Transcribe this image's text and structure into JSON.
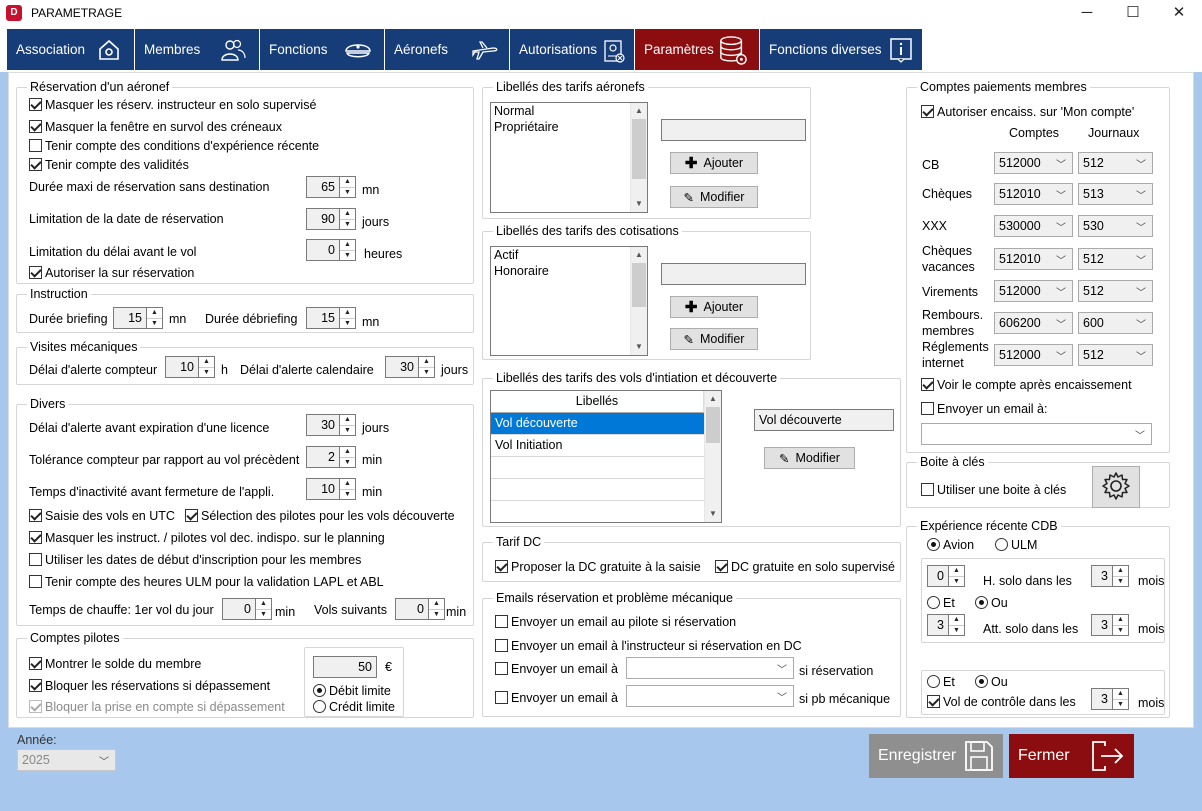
{
  "window": {
    "title": "PARAMETRAGE",
    "logo": "D"
  },
  "colors": {
    "tab_bg": "#173d78",
    "tab_active": "#8c0d10",
    "body_bg": "#a7c8ec",
    "save_btn": "#8f8f8f",
    "close_btn": "#8c0d10"
  },
  "tabs": [
    {
      "label": "Association",
      "icon": "house-gear-icon"
    },
    {
      "label": "Membres",
      "icon": "people-icon"
    },
    {
      "label": "Fonctions",
      "icon": "pilot-cap-icon"
    },
    {
      "label": "Aéronefs",
      "icon": "airplane-icon"
    },
    {
      "label": "Autorisations",
      "icon": "badge-icon"
    },
    {
      "label": "Paramètres",
      "icon": "database-gear-icon",
      "active": true
    },
    {
      "label": "Fonctions diverses",
      "icon": "info-icon"
    }
  ],
  "reservation": {
    "title": "Réservation d'un aéronef",
    "cb1": "Masquer les réserv. instructeur en solo supervisé",
    "cb2": "Masquer la fenêtre en survol des créneaux",
    "cb3": "Tenir compte des conditions d'expérience récente",
    "cb4": "Tenir compte des validités",
    "duree_label": "Durée maxi de réservation sans destination",
    "duree_value": "65",
    "duree_unit": "mn",
    "limdate_label": "Limitation de la date de réservation",
    "limdate_value": "90",
    "limdate_unit": "jours",
    "limdelai_label": "Limitation du délai avant le vol",
    "limdelai_value": "0",
    "limdelai_unit": "heures",
    "cb5": "Autoriser la sur réservation"
  },
  "instruction": {
    "title": "Instruction",
    "briefing_label": "Durée briefing",
    "briefing_value": "15",
    "briefing_unit": "mn",
    "debriefing_label": "Durée débriefing",
    "debriefing_value": "15",
    "debriefing_unit": "mn"
  },
  "visites": {
    "title": "Visites mécaniques",
    "compteur_label": "Délai d'alerte compteur",
    "compteur_value": "10",
    "compteur_unit": "h",
    "calendaire_label": "Délai d'alerte calendaire",
    "calendaire_value": "30",
    "calendaire_unit": "jours"
  },
  "divers": {
    "title": "Divers",
    "licence_label": "Délai d'alerte avant expiration d'une licence",
    "licence_value": "30",
    "licence_unit": "jours",
    "tolerance_label": "Tolérance compteur par rapport au vol précèdent",
    "tolerance_value": "2",
    "tolerance_unit": "min",
    "inactivite_label": "Temps d'inactivité avant fermeture de l'appli.",
    "inactivite_value": "10",
    "inactivite_unit": "min",
    "cb_utc": "Saisie des vols en UTC",
    "cb_selection": "Sélection des pilotes pour les vols découverte",
    "cb_masquer": "Masquer les instruct. / pilotes vol dec. indispo. sur le planning",
    "cb_dates": "Utiliser les dates de début d'inscription pour les membres",
    "cb_ulm": "Tenir compte des heures ULM pour la validation LAPL et ABL",
    "chauffe_label": "Temps de chauffe: 1er vol du jour",
    "chauffe_value": "0",
    "chauffe_unit": "min",
    "suivants_label": "Vols suivants",
    "suivants_value": "0",
    "suivants_unit": "min"
  },
  "comptes_pilotes": {
    "title": "Comptes pilotes",
    "cb1": "Montrer le solde du membre",
    "cb2": "Bloquer les réservations si dépassement",
    "cb3": "Bloquer la prise en compte si dépassement",
    "amount": "50",
    "currency": "€",
    "r1": "Débit limite",
    "r2": "Crédit limite"
  },
  "tarifs_aeronefs": {
    "title": "Libellés des tarifs aéronefs",
    "items": [
      "Normal",
      "Propriétaire"
    ],
    "add": "Ajouter",
    "edit": "Modifier"
  },
  "tarifs_cotisations": {
    "title": "Libellés des tarifs des cotisations",
    "items": [
      "Actif",
      "Honoraire"
    ],
    "add": "Ajouter",
    "edit": "Modifier"
  },
  "tarifs_vols": {
    "title": "Libellés des tarifs des vols d'intiation et découverte",
    "header": "Libellés",
    "rows": [
      "Vol découverte",
      "Vol Initiation"
    ],
    "field": "Vol découverte",
    "edit": "Modifier"
  },
  "tarif_dc": {
    "title": "Tarif DC",
    "cb1": "Proposer la DC gratuite à la saisie",
    "cb2": "DC gratuite en solo supervisé"
  },
  "emails": {
    "title": "Emails réservation et problème mécanique",
    "cb1": "Envoyer un email au pilote si réservation",
    "cb2": "Envoyer un email à l'instructeur si réservation en DC",
    "cb3": "Envoyer un email à",
    "cb3_suffix": "si réservation",
    "cb4": "Envoyer un email à",
    "cb4_suffix": "si pb mécanique"
  },
  "paiements": {
    "title": "Comptes paiements membres",
    "cb1": "Autoriser encaiss. sur 'Mon compte'",
    "col1": "Comptes",
    "col2": "Journaux",
    "rows": [
      {
        "label": "CB",
        "compte": "512000",
        "journal": "512"
      },
      {
        "label": "Chèques",
        "compte": "512010",
        "journal": "513"
      },
      {
        "label": "XXX",
        "compte": "530000",
        "journal": "530"
      },
      {
        "label": "Chèques vacances",
        "compte": "512010",
        "journal": "512"
      },
      {
        "label": "Virements",
        "compte": "512000",
        "journal": "512"
      },
      {
        "label": "Rembours. membres",
        "compte": "606200",
        "journal": "600"
      },
      {
        "label": "Réglements internet",
        "compte": "512000",
        "journal": "512"
      }
    ],
    "cb2": "Voir le compte après encaissement",
    "cb3": "Envoyer un email à:"
  },
  "boite": {
    "title": "Boite à clés",
    "cb": "Utiliser une boite à clés"
  },
  "experience": {
    "title": "Expérience récente CDB",
    "r_avion": "Avion",
    "r_ulm": "ULM",
    "hsolo_value": "0",
    "hsolo_label": "H. solo dans les",
    "hsolo_months": "3",
    "mois": "mois",
    "et": "Et",
    "ou": "Ou",
    "att_value": "3",
    "att_label": "Att. solo dans les",
    "att_months": "3",
    "vol_label": "Vol de contrôle dans les",
    "vol_months": "3"
  },
  "footer": {
    "annee_label": "Année:",
    "annee_value": "2025",
    "save": "Enregistrer",
    "close": "Fermer"
  }
}
